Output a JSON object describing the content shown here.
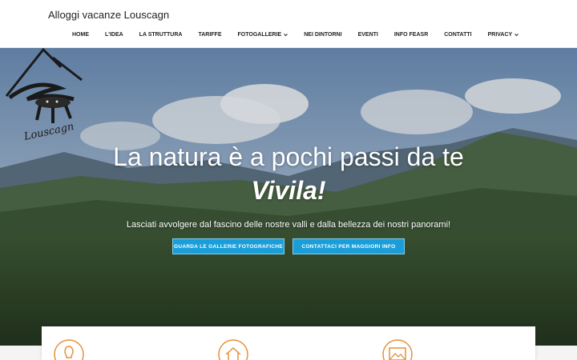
{
  "header": {
    "site_title": "Alloggi vacanze Louscagn"
  },
  "nav": {
    "items": [
      {
        "label": "HOME"
      },
      {
        "label": "L'IDEA"
      },
      {
        "label": "LA STRUTTURA"
      },
      {
        "label": "TARIFFE"
      },
      {
        "label": "FOTOGALLERIE",
        "dropdown": true
      },
      {
        "label": "NEI DINTORNI"
      },
      {
        "label": "EVENTI"
      },
      {
        "label": "INFO FEASR"
      },
      {
        "label": "CONTATTI"
      },
      {
        "label": "PRIVACY",
        "dropdown": true
      }
    ]
  },
  "hero": {
    "title": "La natura è a pochi passi da te",
    "subtitle": "Vivila!",
    "description": "Lasciati avvolgere dal fascino delle nostre valli e dalla bellezza dei nostri panorami!",
    "buttons": {
      "gallery_label": "GUARDA LE GALLERIE FOTOGRAFICHE",
      "contact_label": "CONTATTACI PER MAGGIORI INFO"
    }
  },
  "logo": {
    "text": "Louscagn"
  },
  "features": {
    "icons": [
      "lightbulb-icon",
      "house-icon",
      "image-icon"
    ],
    "accent_color": "#e8913a"
  },
  "colors": {
    "button": "#1a9ed9",
    "accent": "#e8913a"
  }
}
